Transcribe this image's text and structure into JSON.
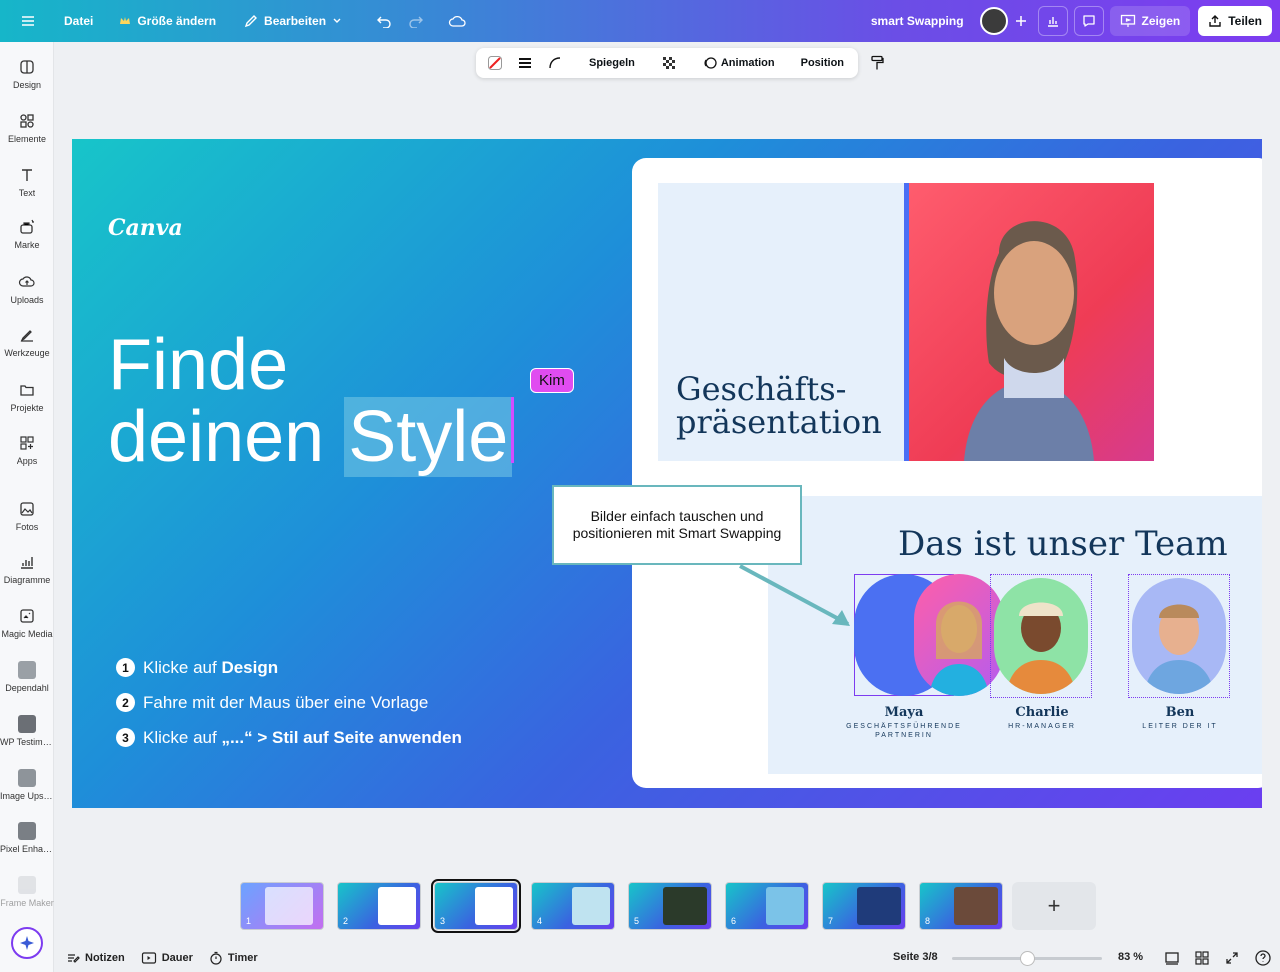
{
  "topbar": {
    "menu_label": "",
    "file_label": "Datei",
    "resize_label": "Größe ändern",
    "edit_label": "Bearbeiten",
    "doc_title": "smart Swapping",
    "present_label": "Zeigen",
    "share_label": "Teilen"
  },
  "sidebar": {
    "items": [
      {
        "label": "Design",
        "icon": "design-icon"
      },
      {
        "label": "Elemente",
        "icon": "elements-icon"
      },
      {
        "label": "Text",
        "icon": "text-icon"
      },
      {
        "label": "Marke",
        "icon": "brand-icon"
      },
      {
        "label": "Uploads",
        "icon": "upload-icon"
      },
      {
        "label": "Werkzeuge",
        "icon": "tools-icon"
      },
      {
        "label": "Projekte",
        "icon": "folder-icon"
      },
      {
        "label": "Apps",
        "icon": "apps-icon"
      },
      {
        "label": "Fotos",
        "icon": "photos-icon"
      },
      {
        "label": "Diagramme",
        "icon": "charts-icon"
      },
      {
        "label": "Magic Media",
        "icon": "magic-media-icon"
      },
      {
        "label": "Dependahl",
        "icon": "app-thumb-icon"
      },
      {
        "label": "WP Testimo...",
        "icon": "app-thumb-icon"
      },
      {
        "label": "Image Upsc...",
        "icon": "app-thumb-icon"
      },
      {
        "label": "Pixel Enhan...",
        "icon": "app-thumb-icon"
      },
      {
        "label": "Frame Maker",
        "icon": "app-thumb-icon"
      }
    ]
  },
  "context_toolbar": {
    "flip_label": "Spiegeln",
    "animation_label": "Animation",
    "position_label": "Position"
  },
  "slide": {
    "logo": "Canva",
    "headline_line1": "Finde",
    "headline_line2a": "deinen ",
    "headline_line2b": "Style",
    "collaborator": "Kim",
    "steps": [
      {
        "num": "1",
        "pre": "Klicke auf ",
        "bold": "Design"
      },
      {
        "num": "2",
        "pre": "Fahre mit der Maus über eine Vorlage",
        "bold": ""
      },
      {
        "num": "3",
        "pre": "Klicke auf ",
        "bold": "„...“ > Stil auf Seite anwenden"
      }
    ],
    "cover_title_line1": "Geschäfts-",
    "cover_title_line2": "präsentation",
    "team_title": "Das ist unser Team",
    "team": [
      {
        "name": "Maya",
        "role": "GESCHÄFTSFÜHRENDE PARTNERIN"
      },
      {
        "name": "Charlie",
        "role": "HR-MANAGER"
      },
      {
        "name": "Ben",
        "role": "LEITER DER IT"
      }
    ],
    "callout": "Bilder einfach tauschen und positionieren mit Smart Swapping"
  },
  "filmstrip": {
    "pages": [
      "1",
      "2",
      "3",
      "4",
      "5",
      "6",
      "7",
      "8"
    ],
    "add_label": "+"
  },
  "bottombar": {
    "notes_label": "Notizen",
    "duration_label": "Dauer",
    "timer_label": "Timer",
    "page_label": "Seite 3/8",
    "zoom_label": "83 %",
    "zoom_level": 0.5
  }
}
